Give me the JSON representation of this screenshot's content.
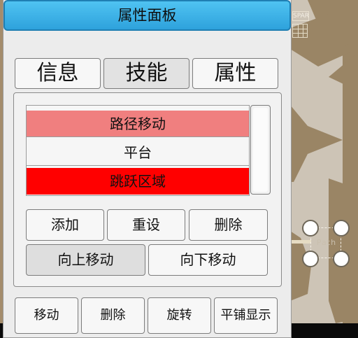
{
  "scene": {
    "top_label": "SPAR",
    "path_label": "Path"
  },
  "panel": {
    "title": "属性面板",
    "tabs": [
      {
        "label": "信息"
      },
      {
        "label": "技能",
        "active": true
      },
      {
        "label": "属性"
      }
    ],
    "skills": [
      {
        "label": "路径移动",
        "color": "#f07f7f"
      },
      {
        "label": "平台",
        "color": "#f6f6f6"
      },
      {
        "label": "跳跃区域",
        "color": "#ff0000"
      }
    ],
    "list_buttons": {
      "add": "添加",
      "reset": "重设",
      "delete": "删除",
      "move_up": "向上移动",
      "move_down": "向下移动"
    },
    "toolbar": {
      "move": "移动",
      "delete": "删除",
      "rotate": "旋转",
      "tile_display": "平铺显示"
    }
  },
  "colors": {
    "title_bar": "#3cb2e8",
    "floor": "#cdc4b6",
    "wall": "#9a8565"
  }
}
